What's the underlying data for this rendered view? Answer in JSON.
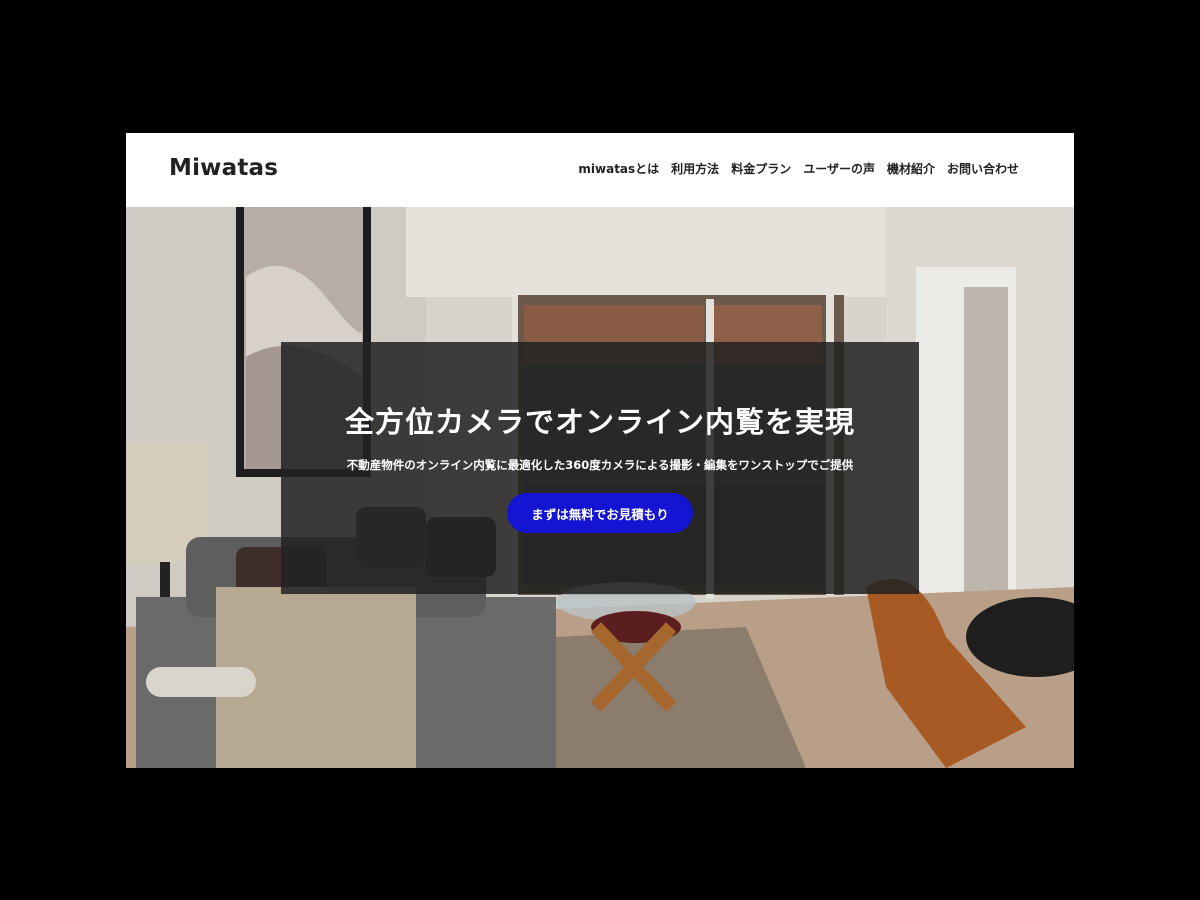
{
  "header": {
    "logo": "Miwatas",
    "nav": [
      {
        "label": "miwatasとは"
      },
      {
        "label": "利用方法"
      },
      {
        "label": "料金プラン"
      },
      {
        "label": "ユーザーの声"
      },
      {
        "label": "機材紹介"
      },
      {
        "label": "お問い合わせ"
      }
    ]
  },
  "hero": {
    "title": "全方位カメラでオンライン内覧を実現",
    "subtitle": "不動産物件のオンライン内覧に最適化した360度カメラによる撮影・編集をワンストップでご提供",
    "cta_label": "まずは無料でお見積もり",
    "accent_color": "#1414d2"
  }
}
